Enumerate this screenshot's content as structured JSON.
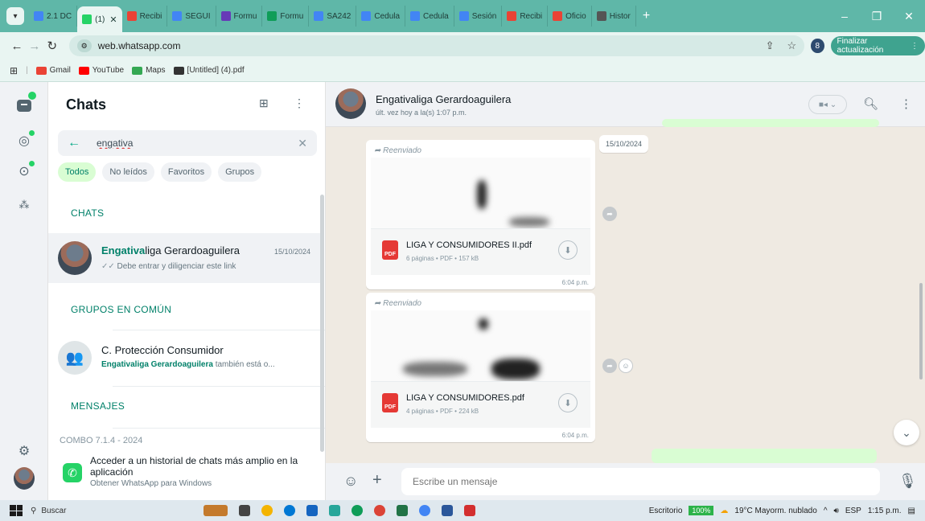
{
  "browser": {
    "tabs": [
      {
        "label": "2.1 DC",
        "color": "#4285f4",
        "active": false
      },
      {
        "label": "(1)",
        "color": "#25d366",
        "active": true
      },
      {
        "label": "Recibi",
        "color": "#ea4335",
        "active": false
      },
      {
        "label": "SEGUI",
        "color": "#4285f4",
        "active": false
      },
      {
        "label": "Formu",
        "color": "#673ab7",
        "active": false
      },
      {
        "label": "Formu",
        "color": "#0f9d58",
        "active": false
      },
      {
        "label": "SA242",
        "color": "#4285f4",
        "active": false
      },
      {
        "label": "Cedula",
        "color": "#4285f4",
        "active": false
      },
      {
        "label": "Cedula",
        "color": "#4285f4",
        "active": false
      },
      {
        "label": "Sesión",
        "color": "#4285f4",
        "active": false
      },
      {
        "label": "Recibi",
        "color": "#ea4335",
        "active": false
      },
      {
        "label": "Oficio",
        "color": "#ea4335",
        "active": false
      },
      {
        "label": "Histor",
        "color": "#555555",
        "active": false
      }
    ],
    "url": "web.whatsapp.com",
    "profile_initial": "8",
    "update_label": "Finalizar actualización",
    "bookmarks": [
      {
        "label": "Gmail",
        "color": "#ea4335"
      },
      {
        "label": "YouTube",
        "color": "#ff0000"
      },
      {
        "label": "Maps",
        "color": "#34a853"
      },
      {
        "label": "[Untitled] (4).pdf",
        "color": "#333333"
      }
    ]
  },
  "sidebar": {
    "title": "Chats",
    "search_value": "engativa",
    "filters": [
      "Todos",
      "No leídos",
      "Favoritos",
      "Grupos"
    ],
    "section_chats": "CHATS",
    "chat_item": {
      "name_match": "Engativa",
      "name_rest": "liga Gerardoaguilera",
      "date": "15/10/2024",
      "preview": "Debe entrar y diligenciar este link"
    },
    "section_groups": "GRUPOS EN COMÚN",
    "group_item": {
      "name": "C. Protección Consumidor",
      "preview_bold": "Engativaliga Gerardoaguilera",
      "preview_rest": "también está o..."
    },
    "section_messages": "MENSAJES",
    "messages_peek": "COMBO 7.1.4 - 2024",
    "promo": {
      "line1": "Acceder a un historial de chats más amplio en la aplicación",
      "line2": "Obtener WhatsApp para Windows"
    }
  },
  "conversation": {
    "contact_name": "Engativaliga Gerardoaguilera",
    "last_seen": "últ. vez hoy a la(s) 1:07 p.m.",
    "date_pill": "15/10/2024",
    "messages": [
      {
        "forwarded": "Reenviado",
        "file": "LIGA Y CONSUMIDORES II.pdf",
        "meta": "6 páginas • PDF • 157 kB",
        "time": "6:04 p.m."
      },
      {
        "forwarded": "Reenviado",
        "file": "LIGA Y CONSUMIDORES.pdf",
        "meta": "4 páginas • PDF • 224 kB",
        "time": "6:04 p.m."
      }
    ],
    "composer_placeholder": "Escribe un mensaje"
  },
  "taskbar": {
    "search": "Buscar",
    "desktop": "Escritorio",
    "battery": "100%",
    "weather": "19°C Mayorm. nublado",
    "lang": "ESP",
    "time": "1:15 p.m."
  },
  "colors": {
    "accent": "#00a884",
    "chrome": "#5fb7a8",
    "chat_bg": "#efeae2"
  }
}
